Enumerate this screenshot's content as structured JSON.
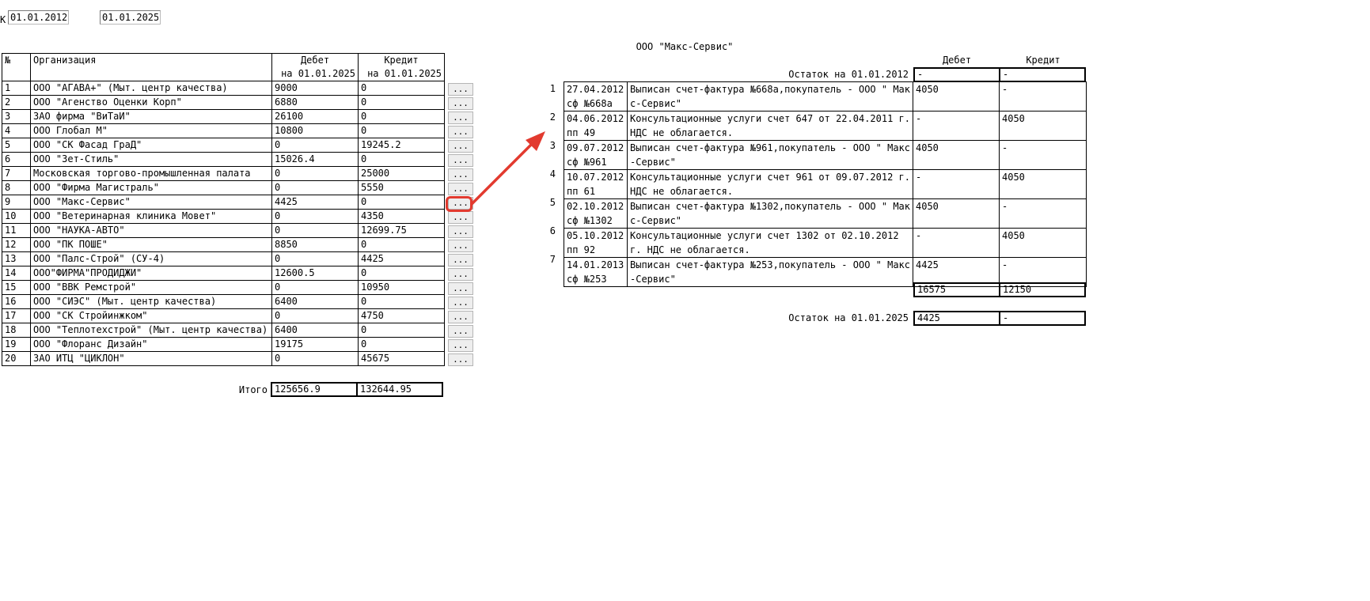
{
  "filter": {
    "label": "К",
    "date_from": "01.01.2012",
    "date_to": "01.01.2025"
  },
  "org_table": {
    "headers": {
      "num": "№",
      "org": "Организация",
      "debit": "Дебет",
      "credit": "Кредит",
      "debit_date": "на 01.01.2025",
      "credit_date": "на 01.01.2025"
    },
    "rows": [
      {
        "num": "1",
        "org": "ООО \"АГАВА+\" (Мыт. центр качества)",
        "debit": "9000",
        "credit": "0"
      },
      {
        "num": "2",
        "org": "ООО \"Агенство Оценки Корп\"",
        "debit": "6880",
        "credit": "0"
      },
      {
        "num": "3",
        "org": "ЗАО фирма \"ВиТаИ\"",
        "debit": "26100",
        "credit": "0"
      },
      {
        "num": "4",
        "org": "ООО Глобал М\"",
        "debit": "10800",
        "credit": "0"
      },
      {
        "num": "5",
        "org": "ООО \"СК Фасад ГраД\"",
        "debit": "0",
        "credit": "19245.2"
      },
      {
        "num": "6",
        "org": "ООО \"Зет-Стиль\"",
        "debit": "15026.4",
        "credit": "0"
      },
      {
        "num": "7",
        "org": "Московская торгово-промышленная палата",
        "debit": "0",
        "credit": "25000"
      },
      {
        "num": "8",
        "org": "ООО \"Фирма Магистраль\"",
        "debit": "0",
        "credit": "5550"
      },
      {
        "num": "9",
        "org": "ООО \"Макс-Сервис\"",
        "debit": "4425",
        "credit": "0"
      },
      {
        "num": "10",
        "org": "ООО \"Ветеринарная клиника Мовет\"",
        "debit": "0",
        "credit": "4350"
      },
      {
        "num": "11",
        "org": "ООО \"НАУКА-АВТО\"",
        "debit": "0",
        "credit": "12699.75"
      },
      {
        "num": "12",
        "org": "ООО \"ПК ПОШЕ\"",
        "debit": "8850",
        "credit": "0"
      },
      {
        "num": "13",
        "org": "ООО \"Палс-Строй\" (СУ-4)",
        "debit": "0",
        "credit": "4425"
      },
      {
        "num": "14",
        "org": "ООО\"ФИРМА\"ПРОДИДЖИ\"",
        "debit": "12600.5",
        "credit": "0"
      },
      {
        "num": "15",
        "org": "ООО \"ВВК Ремстрой\"",
        "debit": "0",
        "credit": "10950"
      },
      {
        "num": "16",
        "org": "ООО \"СИЭС\" (Мыт. центр качества)",
        "debit": "6400",
        "credit": "0"
      },
      {
        "num": "17",
        "org": "ООО \"СК Стройинжком\"",
        "debit": "0",
        "credit": "4750"
      },
      {
        "num": "18",
        "org": "ООО \"Теплотехстрой\" (Мыт. центр качества)",
        "debit": "6400",
        "credit": "0"
      },
      {
        "num": "19",
        "org": "ООО \"Флоранс Дизайн\"",
        "debit": "19175",
        "credit": "0"
      },
      {
        "num": "20",
        "org": "ЗАО ИТЦ \"ЦИКЛОН\"",
        "debit": "0",
        "credit": "45675"
      }
    ],
    "row_button_label": "...",
    "total_label": "Итого",
    "total_debit": "125656.9",
    "total_credit": "132644.95"
  },
  "detail": {
    "org_title": "ООО \"Макс-Сервис\"",
    "debit_header": "Дебет",
    "credit_header": "Кредит",
    "opening_label": "Остаток на 01.01.2012",
    "opening_debit": "-",
    "opening_credit": "-",
    "rows": [
      {
        "num": "1",
        "date": "27.04.2012",
        "doc": "сф №668а",
        "desc": "Выписан счет-фактура №668а,покупатель - ООО \" Макс-Сервис\"",
        "debit": "4050",
        "credit": "-"
      },
      {
        "num": "2",
        "date": "04.06.2012",
        "doc": "пп 49",
        "desc": "Консультационные услуги счет 647 от 22.04.2011 г. НДС не облагается.",
        "debit": "-",
        "credit": "4050"
      },
      {
        "num": "3",
        "date": "09.07.2012",
        "doc": "сф №961",
        "desc": "Выписан счет-фактура №961,покупатель - ООО \" Макс-Сервис\"",
        "debit": "4050",
        "credit": "-"
      },
      {
        "num": "4",
        "date": "10.07.2012",
        "doc": "пп 61",
        "desc": "Консультационные услуги счет 961 от 09.07.2012 г. НДС не облагается.",
        "debit": "-",
        "credit": "4050"
      },
      {
        "num": "5",
        "date": "02.10.2012",
        "doc": "сф №1302",
        "desc": "Выписан счет-фактура №1302,покупатель - ООО \" Макс-Сервис\"",
        "debit": "4050",
        "credit": "-"
      },
      {
        "num": "6",
        "date": "05.10.2012",
        "doc": "пп 92",
        "desc": "Консультационные услуги счет 1302 от 02.10.2012 г. НДС не облагается.",
        "debit": "-",
        "credit": "4050"
      },
      {
        "num": "7",
        "date": "14.01.2013",
        "doc": "сф №253",
        "desc": "Выписан счет-фактура №253,покупатель - ООО \" Макс-Сервис\"",
        "debit": "4425",
        "credit": "-"
      }
    ],
    "sum_debit": "16575",
    "sum_credit": "12150",
    "closing_label": "Остаток на 01.01.2025",
    "closing_debit": "4425",
    "closing_credit": "-"
  },
  "colors": {
    "highlight": "#e23a2f"
  }
}
